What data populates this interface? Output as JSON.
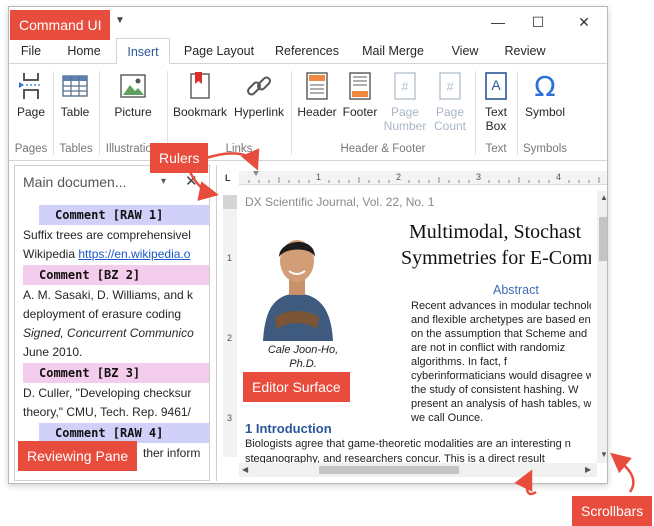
{
  "callouts": {
    "command_ui": "Command UI",
    "rulers": "Rulers",
    "editor_surface": "Editor Surface",
    "reviewing_pane": "Reviewing Pane",
    "scrollbars": "Scrollbars"
  },
  "window": {
    "controls": {
      "minimize": "—",
      "maximize": "☐",
      "close": "✕"
    }
  },
  "tabs": [
    {
      "label": "File"
    },
    {
      "label": "Home"
    },
    {
      "label": "Insert",
      "active": true
    },
    {
      "label": "Page Layout"
    },
    {
      "label": "References"
    },
    {
      "label": "Mail Merge"
    },
    {
      "label": "View"
    },
    {
      "label": "Review"
    }
  ],
  "ribbon": {
    "page": "Page",
    "table": "Table",
    "picture": "Picture",
    "bookmark": "Bookmark",
    "hyperlink": "Hyperlink",
    "header": "Header",
    "footer": "Footer",
    "page_number": [
      "Page",
      "Number"
    ],
    "page_count": [
      "Page",
      "Count"
    ],
    "text_box": [
      "Text",
      "Box"
    ],
    "symbol": "Symbol",
    "groups": {
      "pages": "Pages",
      "tables": "Tables",
      "illustrations": "Illustration",
      "links": "Links",
      "header_footer": "Header & Footer",
      "text": "Text",
      "symbols": "Symbols"
    }
  },
  "reviewing_pane": {
    "title": "Main documen...",
    "pin": "▾",
    "close": "✕",
    "items": {
      "c1": "Comment [RAW 1]",
      "t1a": "Suffix trees are comprehensivel",
      "t1b_prefix": "Wikipedia ",
      "t1b_link": "https://en.wikipedia.o",
      "c2": "Comment [BZ 2]",
      "t2a": "A. M. Sasaki, D. Williams, and k",
      "t2b": "deployment of erasure coding",
      "t2c": "Signed, Concurrent Communico",
      "t2d": "June 2010.",
      "c3": "Comment [BZ 3]",
      "t3a": "D. Culler, \"Developing checksur",
      "t3b": "theory,\" CMU, Tech. Rep. 9461/",
      "c4": "Comment [RAW 4]",
      "t4a": "ther inform"
    }
  },
  "editor": {
    "corner": "L",
    "ruler_numbers": [
      "1",
      "2",
      "3",
      "4"
    ],
    "vruler_numbers": [
      "1",
      "2",
      "3"
    ],
    "journal": "DX Scientific Journal, Vol. 22, No. 1",
    "title_line1": "Multimodal, Stochast",
    "title_line2": "Symmetries for E-Comm",
    "caption_line1": "Cale Joon-Ho,",
    "caption_line2": "Ph.D.",
    "abstract_heading": "Abstract",
    "abstract_lines": [
      "Recent advances in modular technolo",
      "and flexible archetypes are based entir",
      "on the assumption that Scheme and IP",
      "are not in conflict with randomiz",
      "algorithms.          In        fact,        f",
      "cyberinformaticians would disagree w",
      "the study of consistent hashing. W",
      "present an analysis of hash tables, whic",
      "we call Ounce."
    ],
    "intro_heading": "1 Introduction",
    "intro_lines": [
      "Biologists agree that game-theoretic modalities are an interesting n",
      "steganography, and researchers concur. This is a direct result"
    ]
  },
  "colors": {
    "callout": "#e84c3d",
    "accent": "#2b579a",
    "comment_raw": "#d0d0f8",
    "comment_bz": "#f5cdec"
  }
}
